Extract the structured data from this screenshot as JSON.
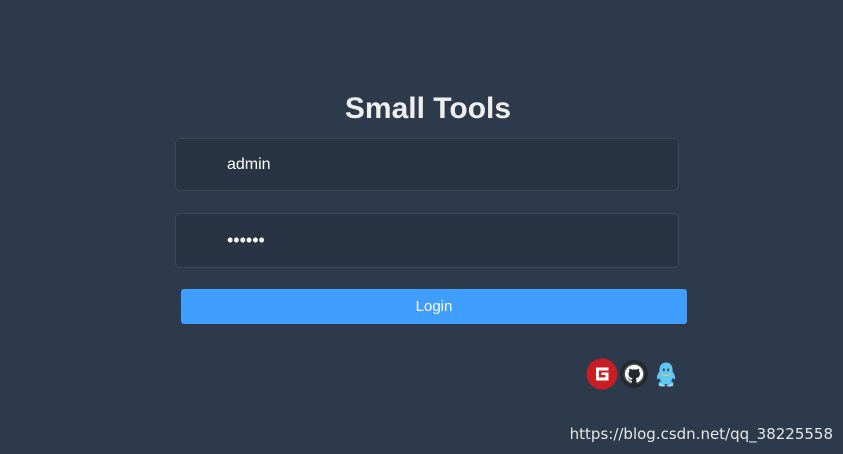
{
  "title": "Small Tools",
  "form": {
    "username_value": "admin",
    "password_value": "123456"
  },
  "login_button": {
    "label": "Login"
  },
  "social_icons": [
    {
      "name": "gitee-icon",
      "color": "#c71d23"
    },
    {
      "name": "github-icon",
      "color": "#24292e"
    },
    {
      "name": "qq-icon",
      "color": "#5ec6f2"
    }
  ],
  "watermark": "https://blog.csdn.net/qq_38225558",
  "colors": {
    "background": "#2d3a4b",
    "input_background": "#283443",
    "primary": "#409eff"
  }
}
